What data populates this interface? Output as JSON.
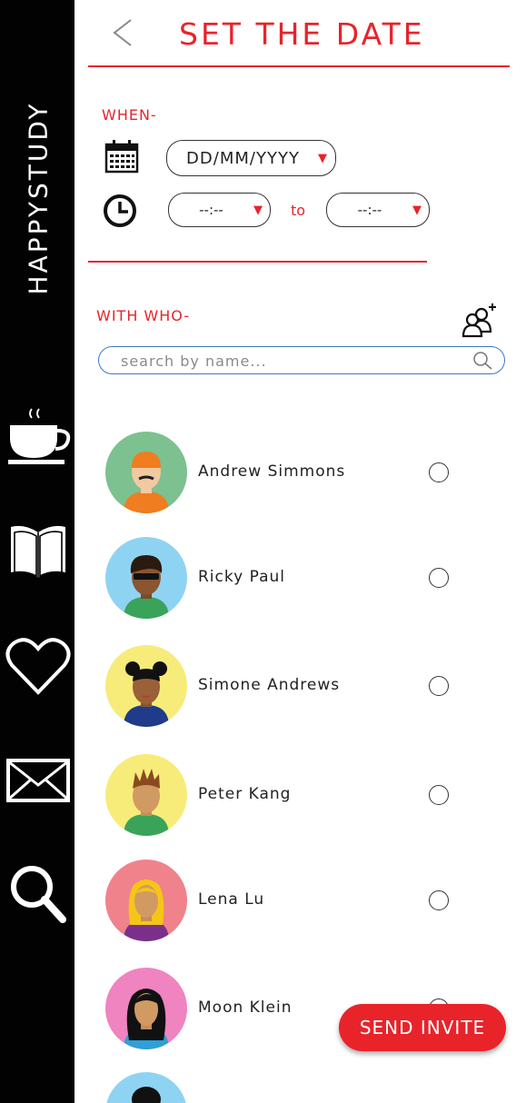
{
  "app": {
    "brand": "HAPPYSTUDY"
  },
  "sidebar": {
    "items": [
      {
        "icon": "coffee-cup-icon"
      },
      {
        "icon": "book-icon"
      },
      {
        "icon": "heart-icon"
      },
      {
        "icon": "mail-icon"
      },
      {
        "icon": "search-icon"
      }
    ]
  },
  "header": {
    "title": "SET THE DATE",
    "back_icon": "chevron-left-icon"
  },
  "when": {
    "label": "WHEN-",
    "date_value": "DD/MM/YYYY",
    "start_time_value": "--:--",
    "end_time_value": "--:--",
    "to_label": "to"
  },
  "with_who": {
    "label": "WITH WHO-",
    "add_icon": "add-group-icon",
    "search_placeholder": "search by name..."
  },
  "contacts": [
    {
      "name": "Andrew Simmons",
      "selected": false
    },
    {
      "name": "Ricky Paul",
      "selected": false
    },
    {
      "name": "Simone Andrews",
      "selected": false
    },
    {
      "name": "Peter Kang",
      "selected": false
    },
    {
      "name": "Lena Lu",
      "selected": false
    },
    {
      "name": "Moon Klein",
      "selected": false
    }
  ],
  "actions": {
    "send_label": "SEND INVITE"
  },
  "colors": {
    "accent": "#e8232a",
    "sidebar": "#020202",
    "search_border": "#3a79c4"
  }
}
